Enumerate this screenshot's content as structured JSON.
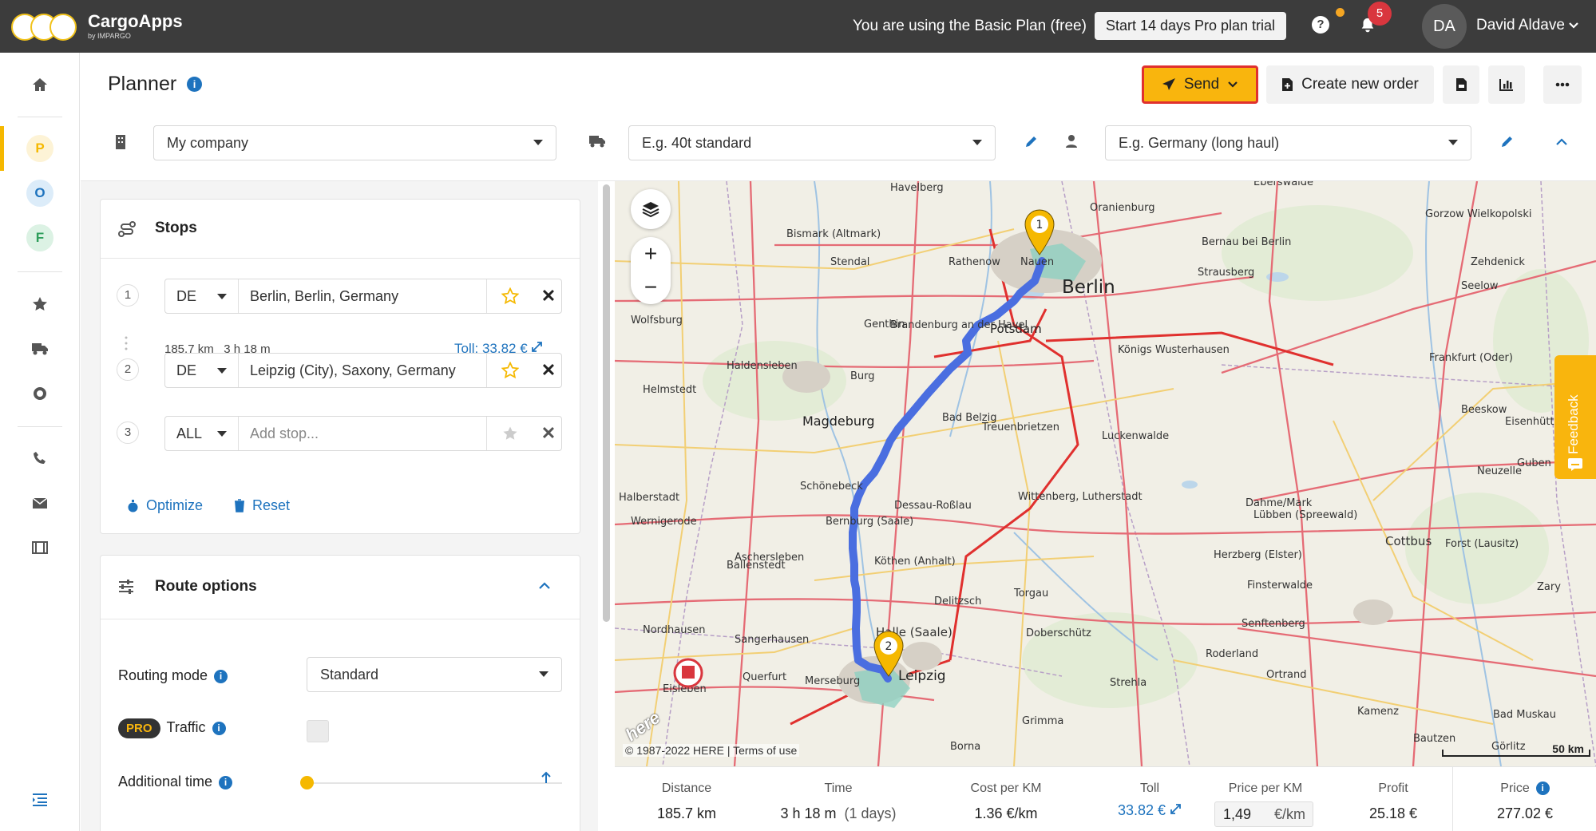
{
  "app": {
    "name": "CargoApps",
    "subtitle": "by IMPARGO"
  },
  "topbar": {
    "plan_message": "You are using the Basic Plan (free)",
    "trial_button": "Start 14 days Pro plan trial",
    "notification_count": "5",
    "user_initials": "DA",
    "user_name": "David Aldave"
  },
  "nav": {
    "circles": [
      {
        "letter": "P",
        "color": "#f5b800",
        "bg": "#fdf3d6"
      },
      {
        "letter": "O",
        "color": "#1e73be",
        "bg": "#dcecf9"
      },
      {
        "letter": "F",
        "color": "#2e9e5b",
        "bg": "#dcf2e4"
      }
    ]
  },
  "header": {
    "title": "Planner",
    "send_label": "Send",
    "create_order_label": "Create new order"
  },
  "selectors": {
    "company": "My company",
    "vehicle_placeholder": "E.g. 40t standard",
    "driver_placeholder": "E.g. Germany (long haul)"
  },
  "stops": {
    "title": "Stops",
    "items": [
      {
        "num": "1",
        "country": "DE",
        "address": "Berlin, Berlin, Germany"
      },
      {
        "num": "2",
        "country": "DE",
        "address": "Leipzig (City), Saxony, Germany"
      },
      {
        "num": "3",
        "country": "ALL",
        "address": "Add stop..."
      }
    ],
    "leg_distance": "185.7 km",
    "leg_time": "3 h 18 m",
    "leg_toll": "Toll: 33.82 €",
    "optimize_label": "Optimize",
    "reset_label": "Reset"
  },
  "route_options": {
    "title": "Route options",
    "routing_mode_label": "Routing mode",
    "routing_mode_value": "Standard",
    "pro_badge": "PRO",
    "traffic_label": "Traffic",
    "additional_time_label": "Additional time"
  },
  "map": {
    "copyright": "© 1987-2022 HERE | Terms of use",
    "here_logo": "here",
    "scale_label": "50 km",
    "feedback_label": "Feedback",
    "markers": [
      "1",
      "2"
    ],
    "cities": [
      {
        "name": "Berlin"
      },
      {
        "name": "Potsdam"
      },
      {
        "name": "Leipzig"
      },
      {
        "name": "Magdeburg"
      },
      {
        "name": "Halle (Saale)"
      },
      {
        "name": "Dessau-Roßlau"
      },
      {
        "name": "Cottbus"
      },
      {
        "name": "Oranienburg"
      },
      {
        "name": "Brandenburg an der Havel"
      },
      {
        "name": "Wittenberg, Lutherstadt"
      },
      {
        "name": "Bernburg (Saale)"
      },
      {
        "name": "Köthen (Anhalt)"
      },
      {
        "name": "Merseburg"
      },
      {
        "name": "Torgau"
      },
      {
        "name": "Nordhausen"
      },
      {
        "name": "Sangerhausen"
      },
      {
        "name": "Stendal"
      },
      {
        "name": "Königs Wusterhausen"
      },
      {
        "name": "Frankfurt (Oder)"
      },
      {
        "name": "Gorzow Wielkopolski"
      },
      {
        "name": "Bautzen"
      },
      {
        "name": "Halberstadt"
      },
      {
        "name": "Wernigerode"
      },
      {
        "name": "Lübben (Spreewald)"
      },
      {
        "name": "Grimma"
      },
      {
        "name": "Luckenwalde"
      },
      {
        "name": "Bad Belzig"
      },
      {
        "name": "Eisenhüttenstadt"
      },
      {
        "name": "Havelberg"
      },
      {
        "name": "Eberswalde"
      },
      {
        "name": "Rathenow"
      },
      {
        "name": "Nauen"
      },
      {
        "name": "Bernau bei Berlin"
      },
      {
        "name": "Strausberg"
      },
      {
        "name": "Genthin"
      },
      {
        "name": "Burg"
      },
      {
        "name": "Schönebeck"
      },
      {
        "name": "Aschersleben"
      },
      {
        "name": "Eisleben"
      },
      {
        "name": "Querfurt"
      },
      {
        "name": "Herzberg (Elster)"
      },
      {
        "name": "Finsterwalde"
      },
      {
        "name": "Senftenberg"
      },
      {
        "name": "Ortrand"
      },
      {
        "name": "Kamenz"
      },
      {
        "name": "Görlitz"
      },
      {
        "name": "Zary"
      },
      {
        "name": "Forst (Lausitz)"
      },
      {
        "name": "Guben"
      },
      {
        "name": "Beeskow"
      },
      {
        "name": "Neuzelle"
      },
      {
        "name": "Seelow"
      },
      {
        "name": "Zehdenick"
      },
      {
        "name": "Bismark (Altmark)"
      },
      {
        "name": "Haldensleben"
      },
      {
        "name": "Helmstedt"
      },
      {
        "name": "Wolfsburg"
      },
      {
        "name": "Ballenstedt"
      },
      {
        "name": "Delitzsch"
      },
      {
        "name": "Doberschütz"
      },
      {
        "name": "Dahme/Mark"
      },
      {
        "name": "Treuenbrietzen"
      },
      {
        "name": "Borna"
      },
      {
        "name": "Strehla"
      },
      {
        "name": "Roderland"
      },
      {
        "name": "Bad Muskau"
      }
    ]
  },
  "summary": {
    "distance_label": "Distance",
    "distance_value": "185.7 km",
    "time_label": "Time",
    "time_value": "3 h 18 m",
    "time_days": "(1 days)",
    "cost_label": "Cost per KM",
    "cost_value": "1.36 €/km",
    "toll_label": "Toll",
    "toll_value": "33.82 €",
    "ppk_label": "Price per KM",
    "ppk_value": "1,49",
    "ppk_unit": "€/km",
    "profit_label": "Profit",
    "profit_value": "25.18 €",
    "price_label": "Price",
    "price_value": "277.02 €"
  },
  "colors": {
    "accent": "#f9b50d",
    "link": "#1e73be",
    "route": "#4a6ee0"
  }
}
